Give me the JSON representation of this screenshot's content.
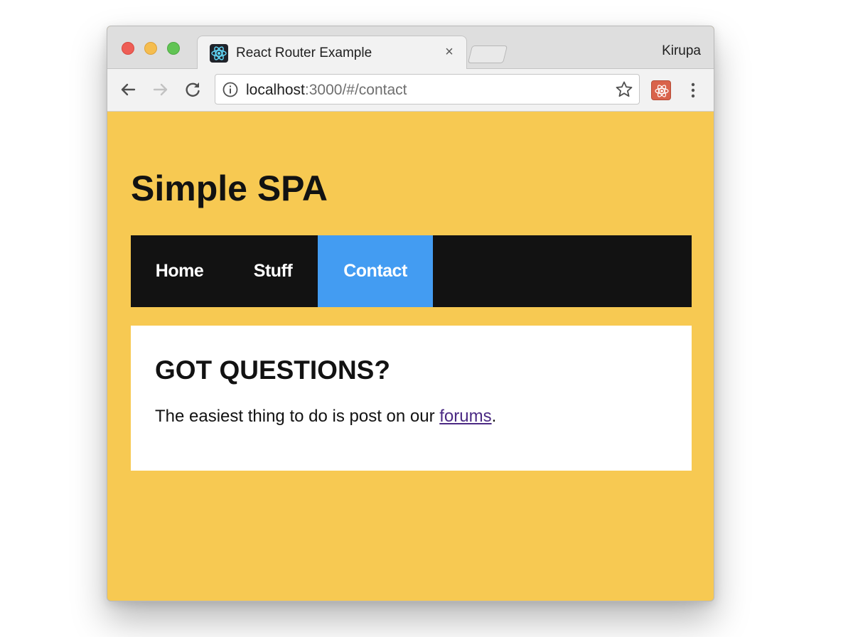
{
  "browser": {
    "tab": {
      "title": "React Router Example",
      "close_label": "×"
    },
    "profile_name": "Kirupa",
    "url": {
      "host": "localhost",
      "rest": ":3000/#/contact"
    }
  },
  "page": {
    "site_title": "Simple SPA",
    "nav": {
      "home": "Home",
      "stuff": "Stuff",
      "contact": "Contact"
    },
    "content": {
      "heading": "GOT QUESTIONS?",
      "text_before": "The easiest thing to do is post on our ",
      "link_text": "forums",
      "text_after": "."
    }
  },
  "colors": {
    "page_background": "#f7c952",
    "nav_background": "#121212",
    "nav_active": "#439cf2",
    "link": "#4b2a84"
  },
  "icons": {
    "back": "back-arrow-icon",
    "forward": "forward-arrow-icon",
    "reload": "reload-icon",
    "info": "info-icon",
    "bookmark": "star-icon",
    "extension": "react-devtools-extension-icon",
    "menu": "kebab-menu-icon",
    "favicon": "react-logo-icon"
  }
}
